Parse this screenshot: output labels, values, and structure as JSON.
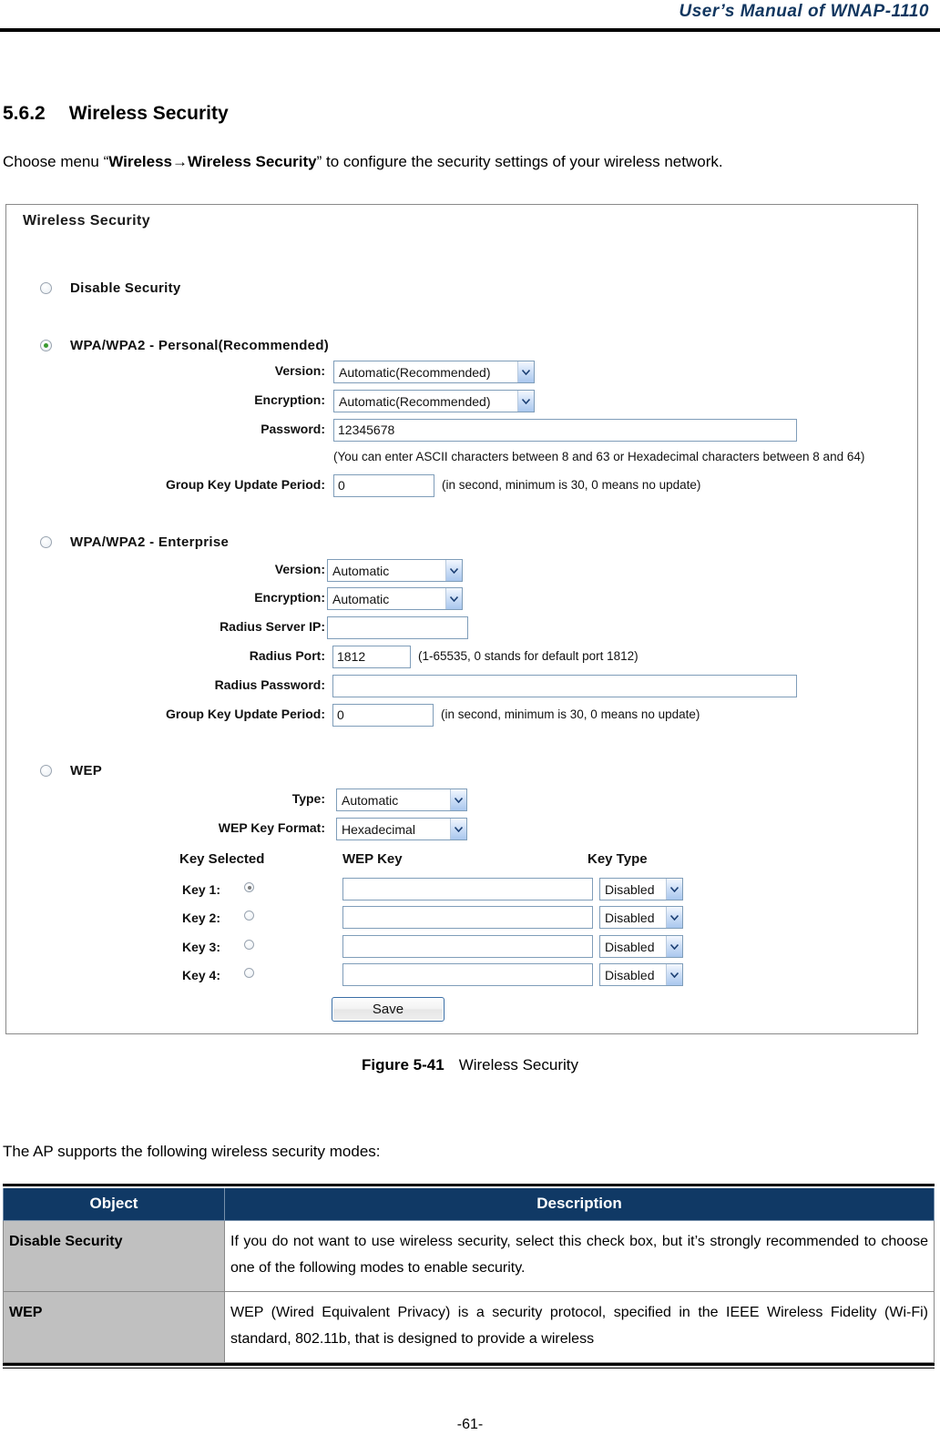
{
  "header": {
    "title": "User’s Manual of WNAP-1110"
  },
  "section": {
    "number": "5.6.2",
    "title": "Wireless Security",
    "intro_prefix": "Choose menu “",
    "intro_bold1": "Wireless",
    "intro_arrow": "→",
    "intro_bold2": "Wireless Security",
    "intro_suffix": "” to configure the security settings of your wireless network."
  },
  "panel": {
    "title": "Wireless Security",
    "modes": {
      "disable": {
        "label": "Disable Security",
        "selected": false
      },
      "wpa_personal": {
        "label": "WPA/WPA2 - Personal(Recommended)",
        "selected": true
      },
      "wpa_enterprise": {
        "label": "WPA/WPA2 - Enterprise",
        "selected": false
      },
      "wep": {
        "label": "WEP",
        "selected": false
      }
    },
    "personal": {
      "version_label": "Version:",
      "version_value": "Automatic(Recommended)",
      "encryption_label": "Encryption:",
      "encryption_value": "Automatic(Recommended)",
      "password_label": "Password:",
      "password_value": "12345678",
      "password_hint": "(You can enter ASCII characters between 8 and 63 or Hexadecimal characters between 8 and 64)",
      "group_key_label": "Group Key Update Period:",
      "group_key_value": "0",
      "group_key_hint": "(in second, minimum is 30, 0 means no update)"
    },
    "enterprise": {
      "version_label": "Version:",
      "version_value": "Automatic",
      "encryption_label": "Encryption:",
      "encryption_value": "Automatic",
      "radius_ip_label": "Radius Server IP:",
      "radius_ip_value": "",
      "radius_port_label": "Radius Port:",
      "radius_port_value": "1812",
      "radius_port_hint": "(1-65535, 0 stands for default port 1812)",
      "radius_password_label": "Radius Password:",
      "radius_password_value": "",
      "group_key_label": "Group Key Update Period:",
      "group_key_value": "0",
      "group_key_hint": "(in second, minimum is 30, 0 means no update)"
    },
    "wep": {
      "type_label": "Type:",
      "type_value": "Automatic",
      "format_label": "WEP Key Format:",
      "format_value": "Hexadecimal",
      "col_key_selected": "Key Selected",
      "col_wep_key": "WEP Key",
      "col_key_type": "Key Type",
      "keys": [
        {
          "label": "Key 1:",
          "selected": true,
          "value": "",
          "type": "Disabled"
        },
        {
          "label": "Key 2:",
          "selected": false,
          "value": "",
          "type": "Disabled"
        },
        {
          "label": "Key 3:",
          "selected": false,
          "value": "",
          "type": "Disabled"
        },
        {
          "label": "Key 4:",
          "selected": false,
          "value": "",
          "type": "Disabled"
        }
      ]
    },
    "save_label": "Save"
  },
  "caption": {
    "figure": "Figure 5-41",
    "text": "Wireless Security"
  },
  "body": {
    "lead": "The AP supports the following wireless security modes:"
  },
  "table": {
    "headers": {
      "object": "Object",
      "description": "Description"
    },
    "rows": [
      {
        "object": "Disable Security",
        "description": "If you do not want to use wireless security, select this check box, but it’s strongly recommended to choose one of the following modes to enable security."
      },
      {
        "object": "WEP",
        "description": "WEP (Wired Equivalent Privacy) is a security protocol, specified in the IEEE Wireless Fidelity (Wi-Fi) standard, 802.11b, that is designed to provide a wireless"
      }
    ]
  },
  "footer": {
    "page": "-61-"
  },
  "colors": {
    "header_navy": "#11365f",
    "table_header_navy": "#103965",
    "object_cell_grey": "#c0c0c0",
    "radio_accent": "#3a9a30",
    "input_border": "#7f9db9"
  }
}
